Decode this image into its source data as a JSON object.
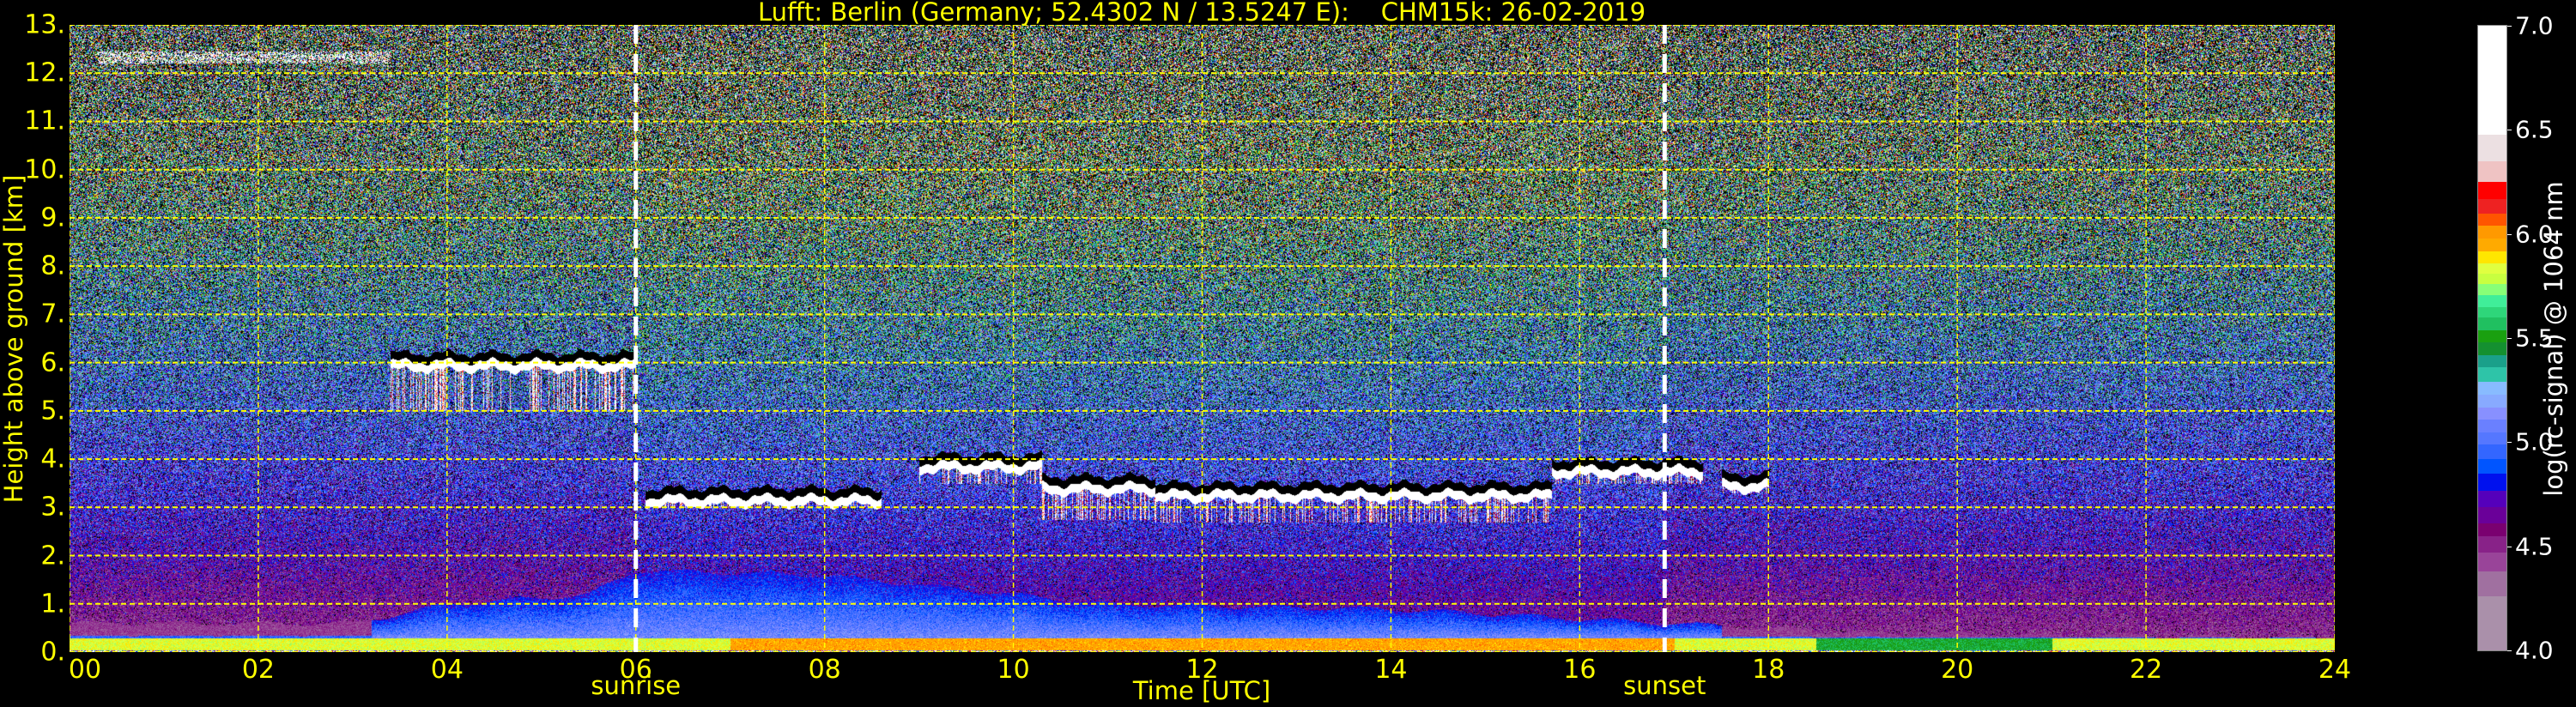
{
  "title": "Lufft: Berlin (Germany; 52.4302 N / 13.5247 E):    CHM15k: 26-02-2019",
  "chart_data": {
    "type": "heatmap",
    "title": "Lufft: Berlin (Germany; 52.4302 N / 13.5247 E):    CHM15k: 26-02-2019",
    "xlabel": "Time [UTC]",
    "ylabel": "Height above ground [km]",
    "xlim": [
      0,
      24
    ],
    "ylim": [
      0,
      13
    ],
    "xticks": [
      0,
      2,
      4,
      6,
      8,
      10,
      12,
      14,
      16,
      18,
      20,
      22,
      24
    ],
    "xtick_labels": [
      "00",
      "02",
      "04",
      "06",
      "08",
      "10",
      "12",
      "14",
      "16",
      "18",
      "20",
      "22",
      "24"
    ],
    "yticks": [
      0,
      1,
      2,
      3,
      4,
      5,
      6,
      7,
      8,
      9,
      10,
      11,
      12,
      13
    ],
    "ytick_labels": [
      "0.",
      "1.",
      "2.",
      "3.",
      "4.",
      "5.",
      "6.",
      "7.",
      "8.",
      "9.",
      "10.",
      "11.",
      "12.",
      "13."
    ],
    "grid": true,
    "annotations": [
      {
        "label": "sunrise",
        "x": 6.0
      },
      {
        "label": "sunset",
        "x": 16.9
      }
    ],
    "colorbar": {
      "label": "log(rc-signal) @ 1064 nm",
      "range": [
        4.0,
        7.0
      ],
      "ticks": [
        4.0,
        4.5,
        5.0,
        5.5,
        6.0,
        6.5,
        7.0
      ],
      "tick_labels": [
        "4.0",
        "4.5",
        "5.0",
        "5.5",
        "6.0",
        "6.5",
        "7.0"
      ],
      "levels": [
        4.0,
        4.26,
        4.38,
        4.47,
        4.55,
        4.61,
        4.69,
        4.77,
        4.85,
        4.92,
        4.99,
        5.05,
        5.11,
        5.17,
        5.23,
        5.29,
        5.36,
        5.42,
        5.48,
        5.54,
        5.6,
        5.65,
        5.71,
        5.76,
        5.81,
        5.86,
        5.92,
        5.98,
        6.04,
        6.1,
        6.17,
        6.25,
        6.35,
        6.48
      ],
      "colors": [
        "#aa90aa",
        "#a070a0",
        "#994499",
        "#882288",
        "#7a0070",
        "#6a0099",
        "#5500bb",
        "#0011ee",
        "#0055ff",
        "#3366ff",
        "#5577ff",
        "#6a80ff",
        "#8890ff",
        "#88aaff",
        "#88bbff",
        "#2ec4a8",
        "#1aa08a",
        "#149030",
        "#1aa010",
        "#20c060",
        "#2ed67a",
        "#40ee99",
        "#88ff77",
        "#c8ff40",
        "#e0ff40",
        "#ffe600",
        "#ffaa00",
        "#ff9900",
        "#ff5500",
        "#ee2222",
        "#ff0000",
        "#efc3c3",
        "#ece0e2",
        "#ffffff"
      ]
    },
    "cloud_layers": [
      {
        "t_start": 3.4,
        "t_end": 6.0,
        "base_km": 5.85,
        "virga_to_km": 5.0
      },
      {
        "t_start": 6.1,
        "t_end": 8.6,
        "base_km": 3.05,
        "virga_to_km": 3.0
      },
      {
        "t_start": 9.0,
        "t_end": 10.3,
        "base_km": 3.75,
        "virga_to_km": 3.5
      },
      {
        "t_start": 10.3,
        "t_end": 11.5,
        "base_km": 3.3,
        "virga_to_km": 2.75
      },
      {
        "t_start": 11.5,
        "t_end": 15.7,
        "base_km": 3.15,
        "virga_to_km": 2.7
      },
      {
        "t_start": 15.5,
        "t_end": 17.3,
        "base_km": 3.65,
        "virga_to_km": 3.5
      },
      {
        "t_start": 17.5,
        "t_end": 18.0,
        "base_km": 3.35,
        "virga_to_km": 3.3
      }
    ],
    "cirrus": [
      {
        "t_start": 0.3,
        "t_end": 3.4,
        "base_km": 12.2
      }
    ],
    "boundary_layer_top_km": [
      {
        "t": 0,
        "h": 0.6
      },
      {
        "t": 3,
        "h": 0.6
      },
      {
        "t": 4,
        "h": 1.0
      },
      {
        "t": 5.5,
        "h": 1.2
      },
      {
        "t": 6,
        "h": 1.7
      },
      {
        "t": 8,
        "h": 1.6
      },
      {
        "t": 11,
        "h": 1.0
      },
      {
        "t": 14,
        "h": 0.9
      },
      {
        "t": 17,
        "h": 0.6
      },
      {
        "t": 19,
        "h": 0.4
      },
      {
        "t": 24,
        "h": 0.3
      }
    ]
  }
}
